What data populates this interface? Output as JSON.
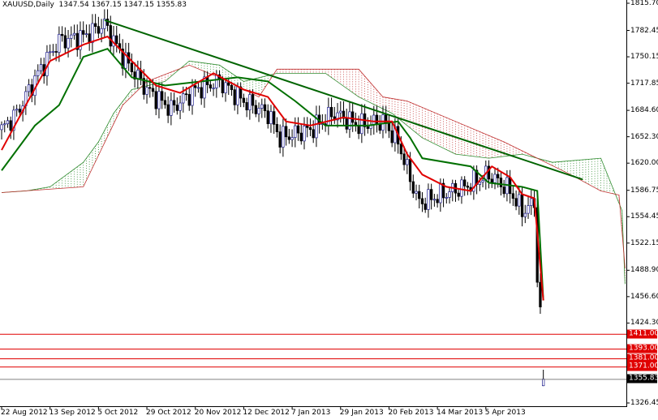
{
  "header": {
    "symbol": "XAUUSD,Daily",
    "ohlc": "1347.54 1367.15 1347.15 1355.83"
  },
  "chart_data": {
    "type": "candlestick",
    "title": "XAUUSD,Daily",
    "ylim": [
      1326.45,
      1815.7
    ],
    "y_ticks": [
      "1815.70",
      "1782.45",
      "1750.15",
      "1717.85",
      "1684.60",
      "1652.30",
      "1620.00",
      "1586.75",
      "1554.45",
      "1522.15",
      "1488.90",
      "1456.60",
      "1424.30",
      "1326.45"
    ],
    "x_ticks": [
      "22 Aug 2012",
      "13 Sep 2012",
      "5 Oct 2012",
      "29 Oct 2012",
      "20 Nov 2012",
      "12 Dec 2012",
      "7 Jan 2013",
      "29 Jan 2013",
      "20 Feb 2013",
      "14 Mar 2013",
      "5 Apr 2013"
    ],
    "x_tick_every_bars": 16,
    "total_bars_with_cloud": 207,
    "close_waypoints": [
      [
        0,
        1661
      ],
      [
        5,
        1681
      ],
      [
        12,
        1730
      ],
      [
        19,
        1770
      ],
      [
        27,
        1775
      ],
      [
        34,
        1790
      ],
      [
        40,
        1750
      ],
      [
        48,
        1710
      ],
      [
        56,
        1686
      ],
      [
        64,
        1710
      ],
      [
        72,
        1720
      ],
      [
        80,
        1696
      ],
      [
        88,
        1681
      ],
      [
        92,
        1651
      ],
      [
        102,
        1661
      ],
      [
        110,
        1681
      ],
      [
        118,
        1666
      ],
      [
        126,
        1671
      ],
      [
        131,
        1646
      ],
      [
        135,
        1601
      ],
      [
        138,
        1571
      ],
      [
        145,
        1581
      ],
      [
        153,
        1591
      ],
      [
        161,
        1606
      ],
      [
        168,
        1586
      ],
      [
        172,
        1561
      ],
      [
        176,
        1571
      ],
      [
        177,
        1482
      ],
      [
        178,
        1433
      ],
      [
        179,
        1355.83
      ]
    ],
    "tenkan_sen": [
      [
        0,
        1636
      ],
      [
        8,
        1691
      ],
      [
        16,
        1745
      ],
      [
        27,
        1765
      ],
      [
        35,
        1775
      ],
      [
        43,
        1745
      ],
      [
        51,
        1715
      ],
      [
        59,
        1706
      ],
      [
        70,
        1730
      ],
      [
        80,
        1710
      ],
      [
        88,
        1701
      ],
      [
        94,
        1671
      ],
      [
        102,
        1666
      ],
      [
        113,
        1676
      ],
      [
        123,
        1671
      ],
      [
        129,
        1671
      ],
      [
        134,
        1631
      ],
      [
        139,
        1606
      ],
      [
        147,
        1591
      ],
      [
        155,
        1586
      ],
      [
        162,
        1616
      ],
      [
        168,
        1603
      ],
      [
        172,
        1582
      ],
      [
        176,
        1577
      ],
      [
        179,
        1452
      ]
    ],
    "kijun_sen": [
      [
        0,
        1611
      ],
      [
        11,
        1666
      ],
      [
        19,
        1691
      ],
      [
        27,
        1750
      ],
      [
        35,
        1760
      ],
      [
        43,
        1725
      ],
      [
        54,
        1715
      ],
      [
        78,
        1725
      ],
      [
        88,
        1720
      ],
      [
        97,
        1696
      ],
      [
        107,
        1666
      ],
      [
        121,
        1666
      ],
      [
        131,
        1671
      ],
      [
        135,
        1651
      ],
      [
        139,
        1626
      ],
      [
        155,
        1616
      ],
      [
        161,
        1596
      ],
      [
        172,
        1591
      ],
      [
        177,
        1586
      ],
      [
        179,
        1452
      ]
    ],
    "senkou_a": [
      [
        0,
        1584
      ],
      [
        8,
        1586
      ],
      [
        16,
        1591
      ],
      [
        27,
        1621
      ],
      [
        32,
        1646
      ],
      [
        37,
        1681
      ],
      [
        43,
        1710
      ],
      [
        54,
        1720
      ],
      [
        62,
        1745
      ],
      [
        72,
        1740
      ],
      [
        80,
        1720
      ],
      [
        91,
        1730
      ],
      [
        107,
        1730
      ],
      [
        118,
        1701
      ],
      [
        129,
        1681
      ],
      [
        139,
        1651
      ],
      [
        150,
        1631
      ],
      [
        161,
        1626
      ],
      [
        172,
        1631
      ],
      [
        182,
        1621
      ],
      [
        198,
        1626
      ],
      [
        205,
        1562
      ],
      [
        206,
        1472
      ]
    ],
    "senkou_b": [
      [
        0,
        1584
      ],
      [
        27,
        1591
      ],
      [
        40,
        1691
      ],
      [
        48,
        1720
      ],
      [
        62,
        1740
      ],
      [
        75,
        1720
      ],
      [
        85,
        1701
      ],
      [
        91,
        1735
      ],
      [
        118,
        1735
      ],
      [
        126,
        1701
      ],
      [
        134,
        1696
      ],
      [
        150,
        1671
      ],
      [
        166,
        1646
      ],
      [
        177,
        1626
      ],
      [
        188,
        1606
      ],
      [
        198,
        1586
      ],
      [
        204,
        1581
      ],
      [
        206,
        1492
      ]
    ],
    "trendline": {
      "from": [
        34,
        1795
      ],
      "to": [
        192,
        1600
      ]
    },
    "levels": [
      {
        "label": "1411.00",
        "value": 1411.0,
        "color": "#e00000"
      },
      {
        "label": "1393.00",
        "value": 1393.0,
        "color": "#e00000"
      },
      {
        "label": "1381.00",
        "value": 1381.0,
        "color": "#e00000"
      },
      {
        "label": "1371.00",
        "value": 1371.0,
        "color": "#e00000"
      }
    ],
    "current_price": {
      "label": "1355.83",
      "value": 1355.83,
      "color": "#000000"
    },
    "colors": {
      "tenkan": "#e00000",
      "kijun": "#007000",
      "trend": "#006400",
      "cloud_bull": "#2e8b2e",
      "cloud_bear": "#c03030"
    }
  }
}
